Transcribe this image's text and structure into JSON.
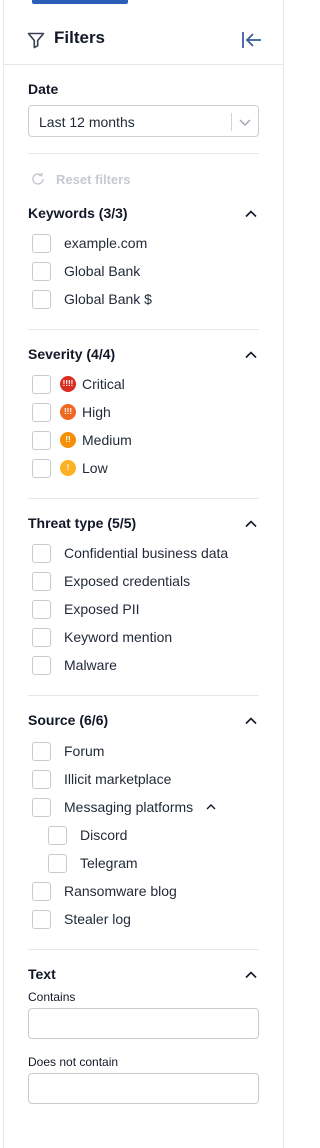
{
  "header": {
    "title": "Filters"
  },
  "date": {
    "label": "Date",
    "selected": "Last 12 months"
  },
  "reset": {
    "label": "Reset filters"
  },
  "keywords": {
    "title": "Keywords (3/3)",
    "items": [
      {
        "label": "example.com"
      },
      {
        "label": "Global Bank"
      },
      {
        "label": "Global Bank $"
      }
    ]
  },
  "severity": {
    "title": "Severity (4/4)",
    "items": [
      {
        "label": "Critical",
        "color": "#d92d20",
        "glyph": "!!!!"
      },
      {
        "label": "High",
        "color": "#ef6820",
        "glyph": "!!!"
      },
      {
        "label": "Medium",
        "color": "#f79009",
        "glyph": "!!"
      },
      {
        "label": "Low",
        "color": "#fdb022",
        "glyph": "!"
      }
    ]
  },
  "threat_type": {
    "title": "Threat type (5/5)",
    "items": [
      {
        "label": "Confidential business data"
      },
      {
        "label": "Exposed credentials"
      },
      {
        "label": "Exposed PII"
      },
      {
        "label": "Keyword mention"
      },
      {
        "label": "Malware"
      }
    ]
  },
  "source": {
    "title": "Source (6/6)",
    "items": [
      {
        "label": "Forum"
      },
      {
        "label": "Illicit marketplace"
      },
      {
        "label": "Messaging platforms"
      },
      {
        "label": "Discord"
      },
      {
        "label": "Telegram"
      },
      {
        "label": "Ransomware blog"
      },
      {
        "label": "Stealer log"
      }
    ]
  },
  "text": {
    "title": "Text",
    "contains_label": "Contains",
    "contains_value": "",
    "not_contains_label": "Does not contain",
    "not_contains_value": ""
  },
  "colors": {
    "accent": "#2b5fb7",
    "disabled": "#c5cad1",
    "border": "#c6cbd2"
  }
}
